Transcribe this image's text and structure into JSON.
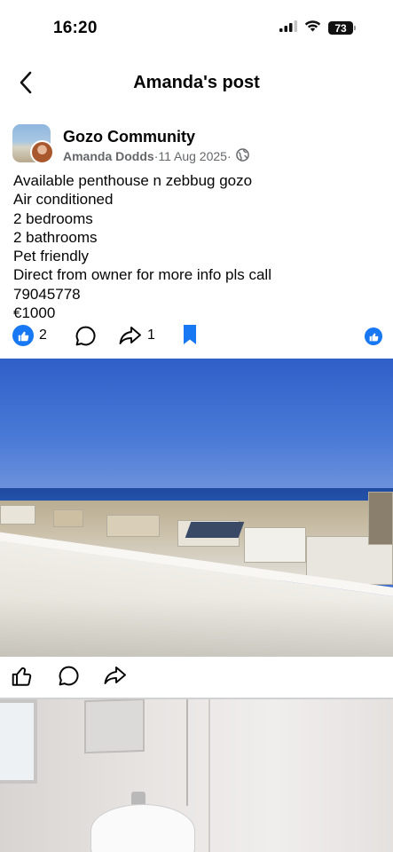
{
  "status_bar": {
    "time": "16:20",
    "battery": "73",
    "icons": [
      "signal-icon",
      "wifi-icon",
      "battery-icon"
    ]
  },
  "nav": {
    "title": "Amanda's post",
    "back_icon": "chevron-left-icon"
  },
  "post": {
    "group_name": "Gozo Community",
    "author": "Amanda Dodds",
    "separator": " · ",
    "date": "11 Aug 2025",
    "separator2": " ·",
    "privacy_icon": "globe-icon",
    "text_lines": [
      "Available penthouse n zebbug gozo",
      "Air conditioned",
      "2 bedrooms",
      "2 bathrooms",
      "Pet friendly",
      "Direct from owner for more info pls call",
      "79045778",
      "€1000"
    ],
    "reactions_count": "2",
    "shares_count": "1"
  },
  "colors": {
    "accent": "#1877f2",
    "text": "#050505",
    "secondary": "#65676b"
  }
}
